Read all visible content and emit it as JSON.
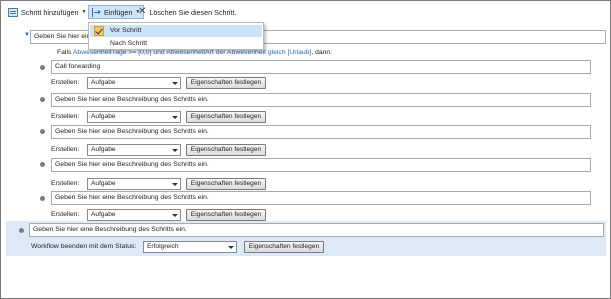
{
  "toolbar": {
    "add_step": "Schritt hinzufügen",
    "insert": "Einfügen",
    "delete_step": "Löschen Sie diesen Schritt."
  },
  "insert_menu": {
    "items": [
      "Vor Schritt",
      "Nach Schritt"
    ],
    "selected_index": 0
  },
  "outer_step": {
    "description": "Geben Sie hier eine"
  },
  "condition": {
    "prefix": "Falls",
    "text": "AbwesenheitTage >= [0,0] und AbwesenheitArt der Abwesenheit gleich [Urlaub]",
    "suffix": ", dann:"
  },
  "labels": {
    "create": "Erstellen:",
    "set_properties": "Eigenschaften festlegen",
    "end_workflow": "Workflow beenden mit dem Status:"
  },
  "inner_steps": [
    {
      "description": "Call forwarding",
      "create_value": "Aufgabe"
    },
    {
      "description": "Geben Sie hier eine Beschreibung des Schritts ein.",
      "create_value": "Aufgabe"
    },
    {
      "description": "Geben Sie hier eine Beschreibung des Schritts ein.",
      "create_value": "Aufgabe"
    },
    {
      "description": "Geben Sie hier eine Beschreibung des Schritts ein.",
      "create_value": "Aufgabe"
    },
    {
      "description": "Geben Sie hier eine Beschreibung des Schritts ein.",
      "create_value": "Aufgabe"
    }
  ],
  "final_step": {
    "description": "Geben Sie hier eine Beschreibung des Schritts ein.",
    "status_value": "Erfolgreich"
  },
  "colors": {
    "selection": "#dde9f7",
    "link": "#2b6ab8",
    "menu_highlight": "#cfe3f7"
  }
}
